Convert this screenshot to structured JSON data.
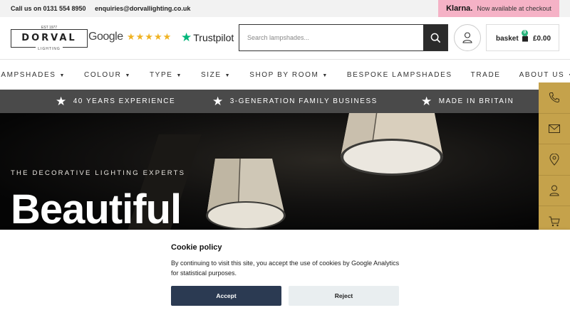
{
  "topbar": {
    "phone": "Call us on 0131 554 8950",
    "email": "enquiries@dorvallighting.co.uk",
    "klarna_logo": "Klarna.",
    "klarna_text": "Now available at checkout"
  },
  "brand": {
    "est": "EST 1977",
    "name": "DORVAL",
    "sub": "LIGHTING"
  },
  "reviews": {
    "google": "Google",
    "stars": "★★★★★",
    "trustpilot": "Trustpilot"
  },
  "search": {
    "placeholder": "Search lampshades..."
  },
  "basket": {
    "label": "basket",
    "count": "0",
    "total": "£0.00"
  },
  "nav": {
    "items": [
      {
        "label": "LAMPSHADES",
        "caret": "▼"
      },
      {
        "label": "COLOUR",
        "caret": "▼"
      },
      {
        "label": "TYPE",
        "caret": "▼"
      },
      {
        "label": "SIZE",
        "caret": "▼"
      },
      {
        "label": "SHOP BY ROOM",
        "caret": "▼"
      },
      {
        "label": "BESPOKE LAMPSHADES",
        "caret": ""
      },
      {
        "label": "TRADE",
        "caret": ""
      },
      {
        "label": "ABOUT US",
        "caret": "▼"
      }
    ]
  },
  "usp": [
    {
      "text": "40 YEARS EXPERIENCE"
    },
    {
      "text": "3-GENERATION FAMILY BUSINESS"
    },
    {
      "text": "MADE IN BRITAIN"
    }
  ],
  "hero": {
    "tagline": "THE DECORATIVE LIGHTING EXPERTS",
    "headline": "Beautiful"
  },
  "sidebar": {
    "icons": [
      "phone-icon",
      "mail-icon",
      "location-icon",
      "user-icon",
      "cart-icon"
    ]
  },
  "cookie": {
    "title": "Cookie policy",
    "message": "By continuing to visit this site, you accept the use of cookies by Google Analytics for statistical purposes.",
    "accept": "Accept",
    "reject": "Reject"
  },
  "colors": {
    "accent_gold": "#c5a24b",
    "usp_bar": "#4a4a4a",
    "klarna_pink": "#f5b2c6",
    "accept_button": "#2b3a52",
    "trustpilot_green": "#00b67a"
  }
}
